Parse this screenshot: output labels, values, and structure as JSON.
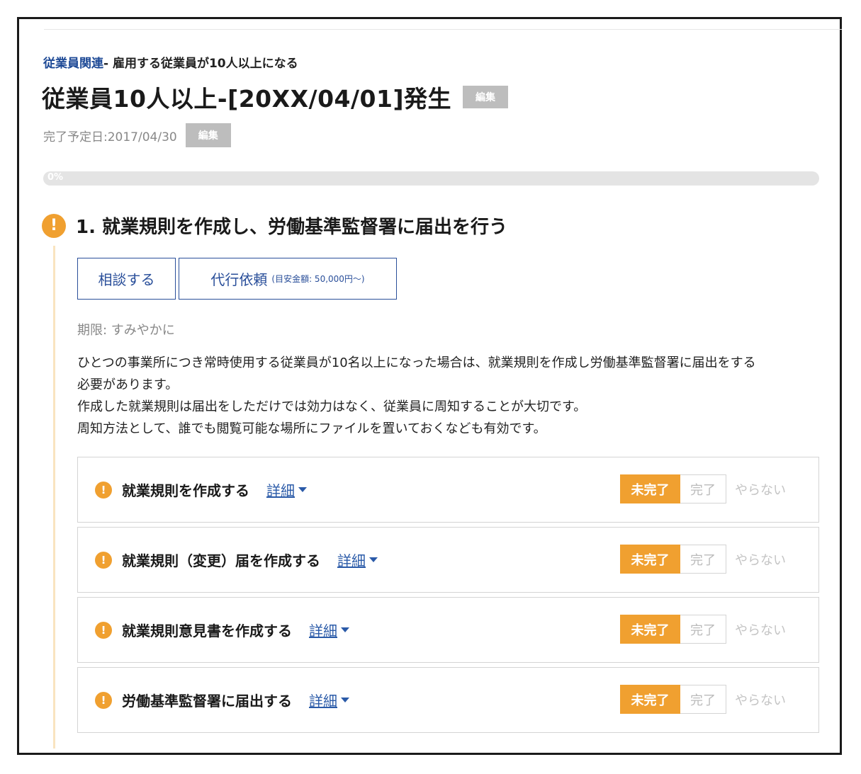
{
  "header": {
    "category": "従業員関連",
    "subtitle": "- 雇用する従業員が10人以上になる",
    "title": "従業員10人以上-[20XX/04/01]発生",
    "edit_label": "編集",
    "due_date": "完了予定日:2017/04/30",
    "due_edit_label": "編集"
  },
  "progress": {
    "percent": 0,
    "label": "0%"
  },
  "section": {
    "title": "1. 就業規則を作成し、労働基準監督署に届出を行う",
    "icon": "exclamation-icon",
    "consult_label": "相談する",
    "proxy_label": "代行依頼",
    "proxy_note": "(目安金額: 50,000円〜)",
    "deadline": "期限: すみやかに",
    "description": [
      "ひとつの事業所につき常時使用する従業員が10名以上になった場合は、就業規則を作成し労働基準監督署に届出をする",
      "必要があります。",
      "作成した就業規則は届出をしただけでは効力はなく、従業員に周知することが大切です。",
      "周知方法として、誰でも閲覧可能な場所にファイルを置いておくなども有効です。"
    ]
  },
  "tasks": [
    {
      "name": "就業規則を作成する",
      "detail": "詳細",
      "status_undone": "未完了",
      "status_done": "完了",
      "status_skip": "やらない"
    },
    {
      "name": "就業規則（変更）届を作成する",
      "detail": "詳細",
      "status_undone": "未完了",
      "status_done": "完了",
      "status_skip": "やらない"
    },
    {
      "name": "就業規則意見書を作成する",
      "detail": "詳細",
      "status_undone": "未完了",
      "status_done": "完了",
      "status_skip": "やらない"
    },
    {
      "name": "労働基準監督署に届出する",
      "detail": "詳細",
      "status_undone": "未完了",
      "status_done": "完了",
      "status_skip": "やらない"
    }
  ],
  "colors": {
    "accent": "#f0a030",
    "link": "#2a5aa8",
    "category": "#1e4a96"
  }
}
